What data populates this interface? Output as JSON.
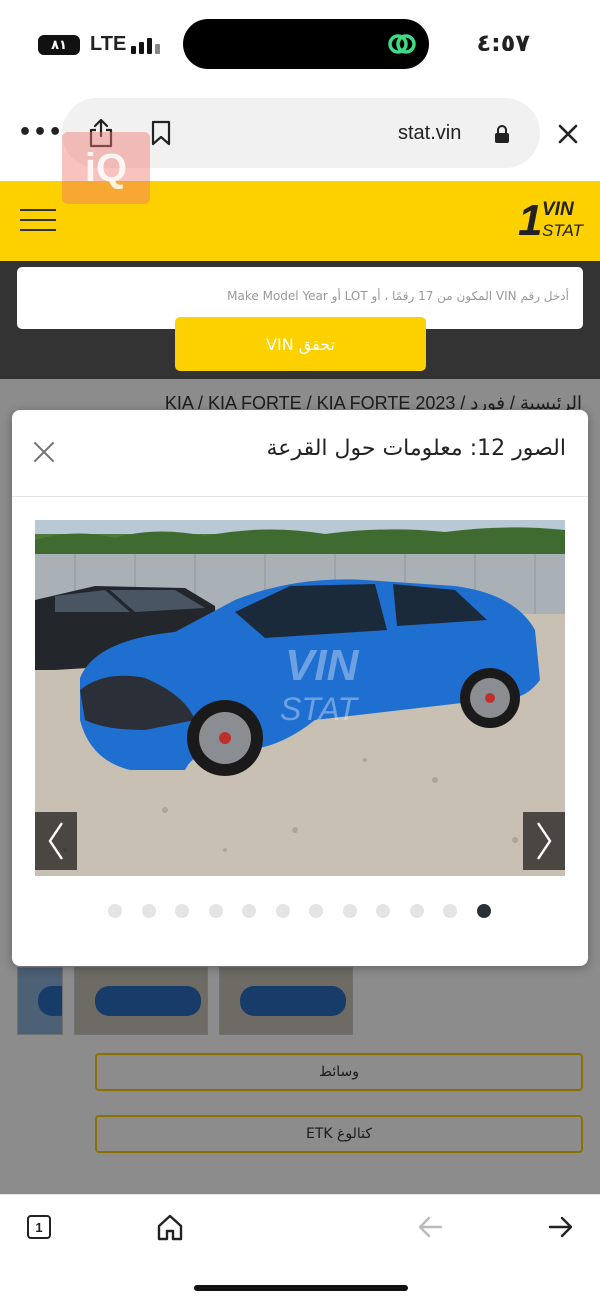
{
  "status_bar": {
    "battery": "٨١",
    "network": "LTE",
    "time": "٤:٥٧"
  },
  "browser": {
    "url": "stat.vin",
    "more_label": "•••",
    "tab_count": "1"
  },
  "watermark": {
    "text": "iQ"
  },
  "site": {
    "logo_number": "1",
    "logo_vin": "VIN",
    "logo_stat": "STAT",
    "search_placeholder": "أدخل رقم VIN المكون من 17 رقمًا ، أو LOT أو Make Model Year",
    "check_button": "تحقق VIN"
  },
  "breadcrumb": "الرئيسية / فورد / KIA / KIA FORTE / KIA FORTE 2023",
  "modal": {
    "title": "الصور 12: معلومات حول القرعة",
    "photo_watermark_vin": "VIN",
    "photo_watermark_stat": "STAT",
    "total_photos": 12,
    "active_photo": 12
  },
  "buttons": {
    "media": "وسائط",
    "catalog": "كتالوغ ETK"
  },
  "icons": [
    "share-icon",
    "bookmark-icon",
    "lock-icon",
    "close-icon",
    "hamburger-icon",
    "chevron-left-icon",
    "chevron-right-icon",
    "home-icon",
    "back-arrow-icon",
    "forward-arrow-icon"
  ],
  "colors": {
    "brand_yellow": "#fdd000",
    "dark_band": "#333333",
    "active_dot": "#263238"
  }
}
